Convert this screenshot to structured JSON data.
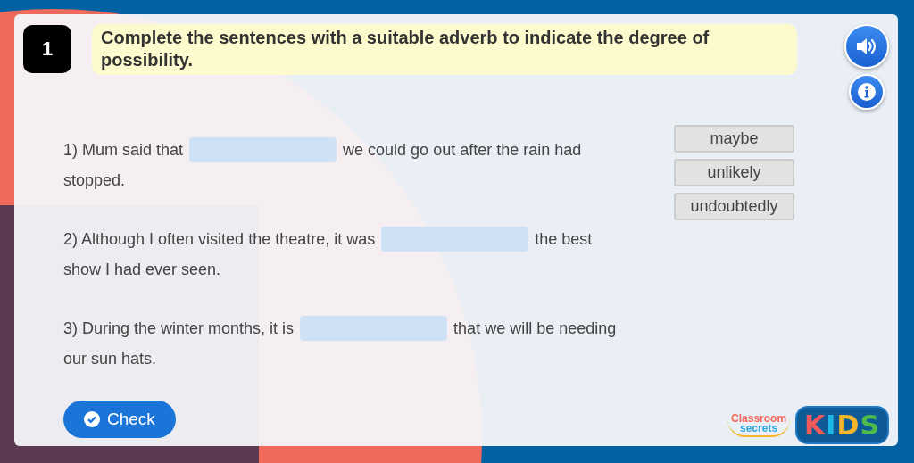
{
  "question": {
    "number": "1",
    "instruction": "Complete the sentences with a suitable adverb to indicate the degree of possibility."
  },
  "sentences": [
    {
      "before": "1) Mum said that",
      "after": "we could go out after the rain had",
      "continued": "stopped."
    },
    {
      "before": "2) Although I often visited the theatre, it was",
      "after": "the best",
      "continued": "show I had ever seen."
    },
    {
      "before": "3) During the winter months, it is",
      "after": "that we will be needing",
      "continued": "our sun hats."
    }
  ],
  "word_bank": [
    "maybe",
    "unlikely",
    "undoubtedly"
  ],
  "check_button": "Check",
  "logo": {
    "top": "Classroom",
    "bottom": "secrets",
    "badge": "KIDS"
  }
}
